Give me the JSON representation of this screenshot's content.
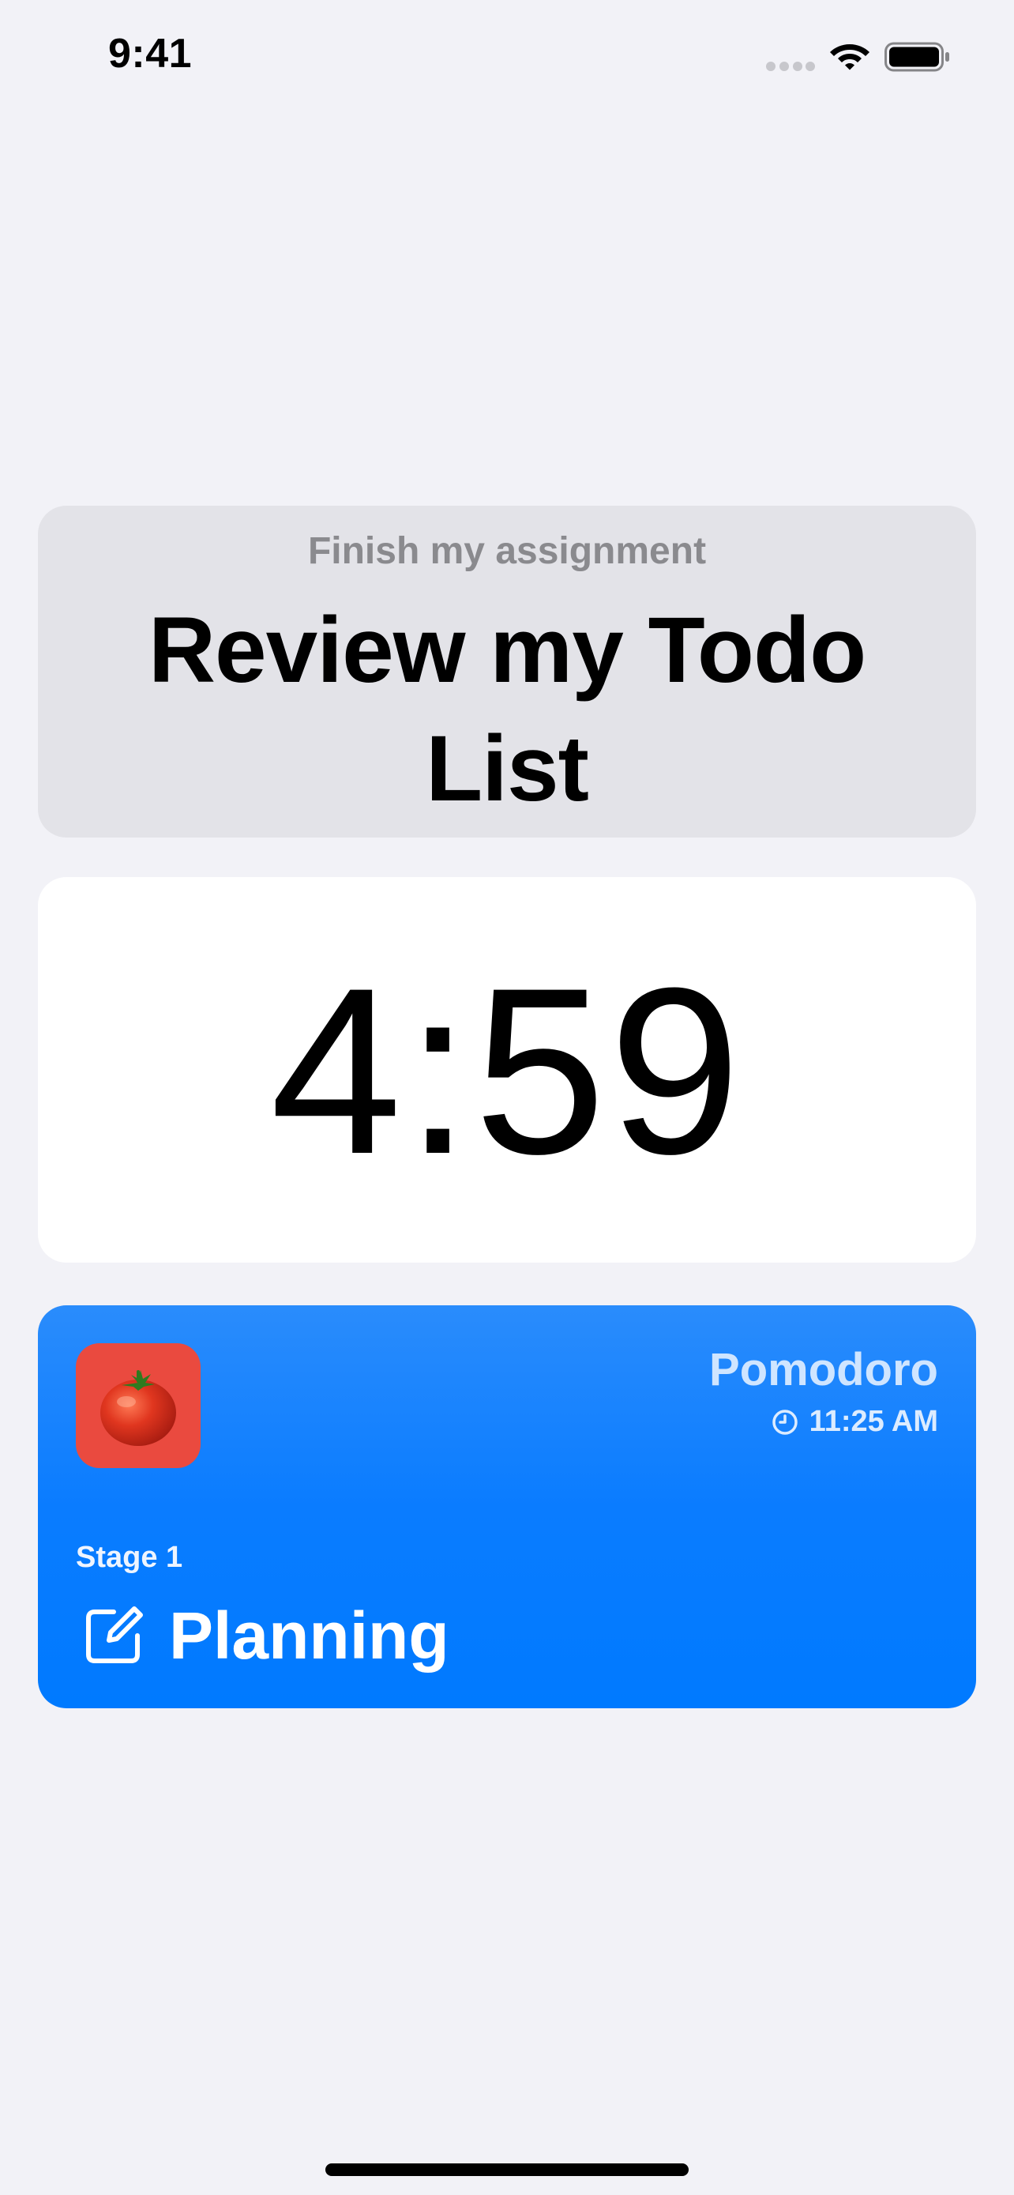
{
  "status_bar": {
    "time": "9:41"
  },
  "task": {
    "subtitle": "Finish my assignment",
    "title": "Review my Todo List"
  },
  "timer": {
    "remaining": "4:59"
  },
  "pomodoro": {
    "app_name": "Pomodoro",
    "time": "11:25 AM",
    "stage_label": "Stage 1",
    "stage_name": "Planning",
    "app_icon": "tomato-icon",
    "time_icon": "clock-icon",
    "stage_icon": "edit-icon"
  },
  "colors": {
    "background": "#f2f2f7",
    "task_card": "#e3e3e8",
    "timer_card": "#ffffff",
    "accent_blue": "#007aff",
    "app_tile_red": "#ea4a3f"
  }
}
